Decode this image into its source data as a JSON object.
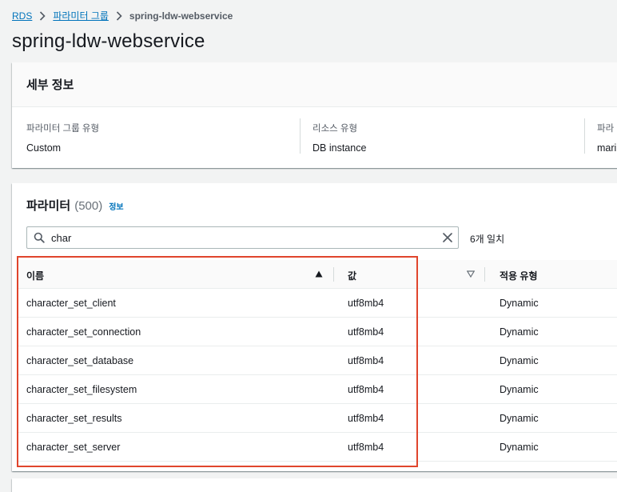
{
  "breadcrumb": {
    "items": [
      "RDS",
      "파라미터 그룹"
    ],
    "current": "spring-ldw-webservice"
  },
  "page": {
    "title": "spring-ldw-webservice"
  },
  "details": {
    "header": "세부 정보",
    "fields": [
      {
        "label": "파라미터 그룹 유형",
        "value": "Custom"
      },
      {
        "label": "리소스 유형",
        "value": "DB instance"
      },
      {
        "label": "파라",
        "value": "mari"
      }
    ]
  },
  "parameters": {
    "title": "파라미터",
    "count": "(500)",
    "info_link": "정보",
    "search": {
      "value": "char",
      "placeholder": ""
    },
    "match_count": "6개 일치",
    "columns": [
      "이름",
      "값",
      "적용 유형"
    ],
    "rows": [
      {
        "name": "character_set_client",
        "value": "utf8mb4",
        "apply_type": "Dynamic"
      },
      {
        "name": "character_set_connection",
        "value": "utf8mb4",
        "apply_type": "Dynamic"
      },
      {
        "name": "character_set_database",
        "value": "utf8mb4",
        "apply_type": "Dynamic"
      },
      {
        "name": "character_set_filesystem",
        "value": "utf8mb4",
        "apply_type": "Dynamic"
      },
      {
        "name": "character_set_results",
        "value": "utf8mb4",
        "apply_type": "Dynamic"
      },
      {
        "name": "character_set_server",
        "value": "utf8mb4",
        "apply_type": "Dynamic"
      }
    ]
  },
  "colors": {
    "link": "#0073bb",
    "highlight_border": "#e0452c",
    "background": "#f2f3f3"
  }
}
